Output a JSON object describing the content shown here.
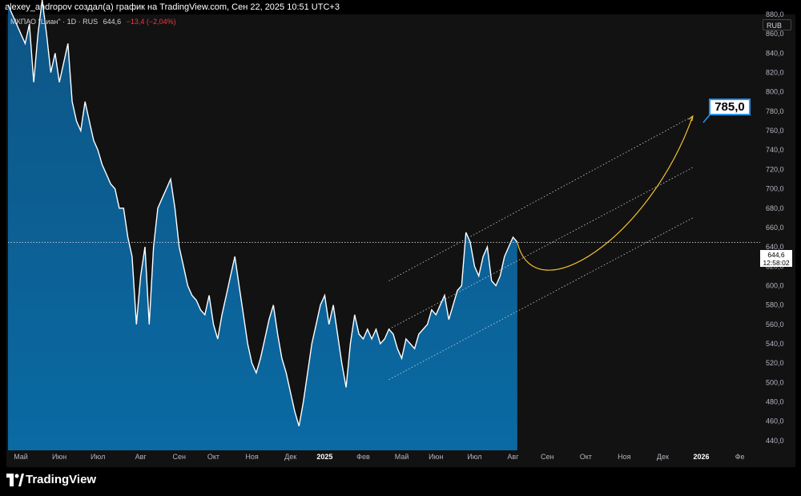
{
  "header": {
    "caption": "alexey_andropov создал(а) график на TradingView.com, Сен 22, 2025 10:51 UTC+3"
  },
  "legend": {
    "symbol": "МКПАО \"Циан\" · 1D · RUS",
    "last": "644,6",
    "change": "−13,4 (−2,04%)"
  },
  "currency": "RUB",
  "price_tag": {
    "price": "644,6",
    "countdown": "12:58:02"
  },
  "target_label": "785,0",
  "footer": {
    "brand": "TradingView"
  },
  "colors": {
    "up_line": "#ffffff",
    "area_top": "#0e5585",
    "area_bottom": "#0a6aa3",
    "projection": "#f2c12e",
    "target_border": "#2196f3"
  },
  "chart_data": {
    "type": "area",
    "ylim": [
      430,
      880
    ],
    "yticks": [
      "880,0",
      "860,0",
      "840,0",
      "820,0",
      "800,0",
      "780,0",
      "760,0",
      "740,0",
      "720,0",
      "700,0",
      "680,0",
      "660,0",
      "640,0",
      "620,0",
      "600,0",
      "580,0",
      "560,0",
      "540,0",
      "520,0",
      "500,0",
      "480,0",
      "460,0",
      "440,0"
    ],
    "ytick_values": [
      880,
      860,
      840,
      820,
      800,
      780,
      760,
      740,
      720,
      700,
      680,
      660,
      640,
      620,
      600,
      580,
      560,
      540,
      520,
      500,
      480,
      460,
      440
    ],
    "xticks": [
      "Май",
      "Июн",
      "Июл",
      "Авг",
      "Сен",
      "Окт",
      "Ноя",
      "Дек",
      "2025",
      "Фев",
      "Май",
      "Июн",
      "Июл",
      "Авг",
      "Сен",
      "Окт",
      "Ноя",
      "Дек",
      "2026",
      "Фе"
    ],
    "xtick_bold": [
      false,
      false,
      false,
      false,
      false,
      false,
      false,
      false,
      true,
      false,
      false,
      false,
      false,
      false,
      false,
      false,
      false,
      false,
      true,
      false
    ],
    "xtick_index": [
      3,
      12,
      21,
      31,
      40,
      48,
      57,
      66,
      74,
      83,
      92,
      100,
      109,
      118,
      126,
      135,
      144,
      153,
      162,
      171
    ],
    "series": [
      {
        "close": [
          890,
          880,
          870,
          860,
          850,
          870,
          810,
          860,
          895,
          860,
          820,
          840,
          810,
          830,
          850,
          790,
          770,
          760,
          790,
          770,
          750,
          740,
          725,
          715,
          705,
          700,
          680,
          680,
          650,
          630,
          560,
          610,
          640,
          560,
          640,
          680,
          690,
          700,
          710,
          680,
          640,
          620,
          600,
          590,
          585,
          575,
          570,
          590,
          560,
          545,
          570,
          590,
          610,
          630,
          600,
          570,
          540,
          520,
          510,
          525,
          545,
          565,
          580,
          550,
          525,
          510,
          490,
          470,
          455,
          480,
          510,
          540,
          560,
          580,
          590,
          560,
          580,
          550,
          520,
          495,
          540,
          570,
          550,
          545,
          555,
          545,
          555,
          540,
          545,
          555,
          550,
          535,
          525,
          545,
          540,
          535,
          550,
          555,
          560,
          575,
          570,
          580,
          590,
          565,
          580,
          595,
          600,
          655,
          645,
          620,
          610,
          630,
          640,
          605,
          600,
          610,
          630,
          640,
          650,
          645
        ]
      }
    ],
    "annotations": {
      "current_price": 644.6,
      "target": 785.0
    }
  }
}
